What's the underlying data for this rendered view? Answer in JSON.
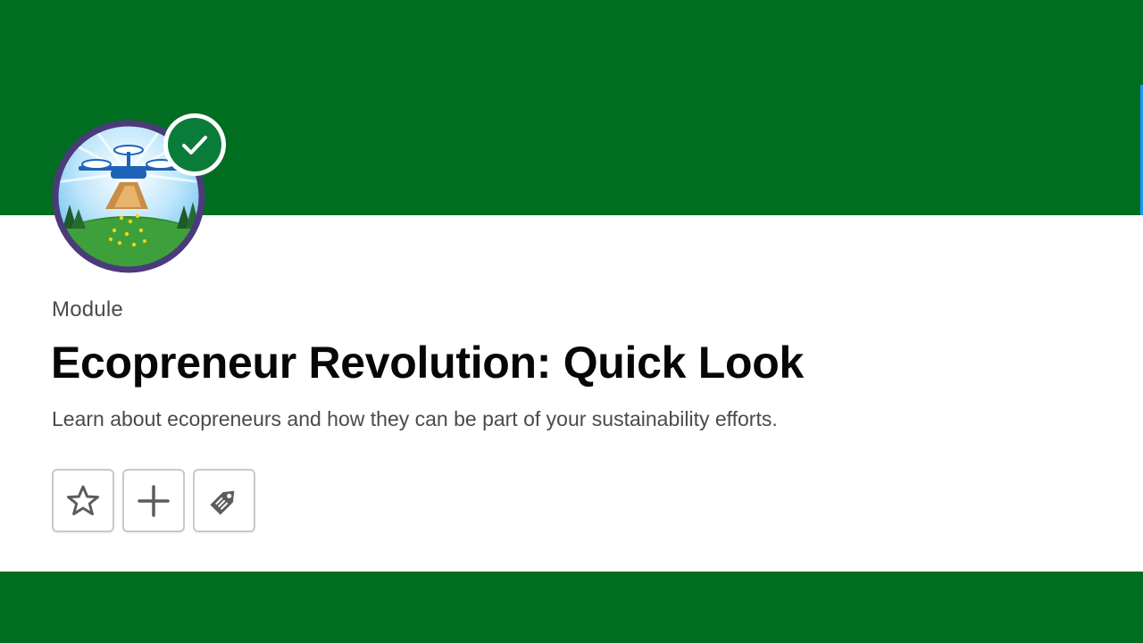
{
  "colors": {
    "brand_green": "#016d21",
    "accent_blue": "#1b96ff",
    "badge_ring": "#4b3b7a",
    "check_green": "#0a7c3a",
    "text_primary": "#080707",
    "text_secondary": "#4a4a4a",
    "icon_gray": "#5c5c5c"
  },
  "badge": {
    "icon": "drone-seed-planting-badge",
    "completed": true,
    "status_icon": "checkmark-icon"
  },
  "module": {
    "eyebrow": "Module",
    "title": "Ecopreneur Revolution: Quick Look",
    "description": "Learn about ecopreneurs and how they can be part of your sustainability efforts."
  },
  "actions": [
    {
      "icon": "star-icon"
    },
    {
      "icon": "plus-icon"
    },
    {
      "icon": "tag-icon"
    }
  ]
}
